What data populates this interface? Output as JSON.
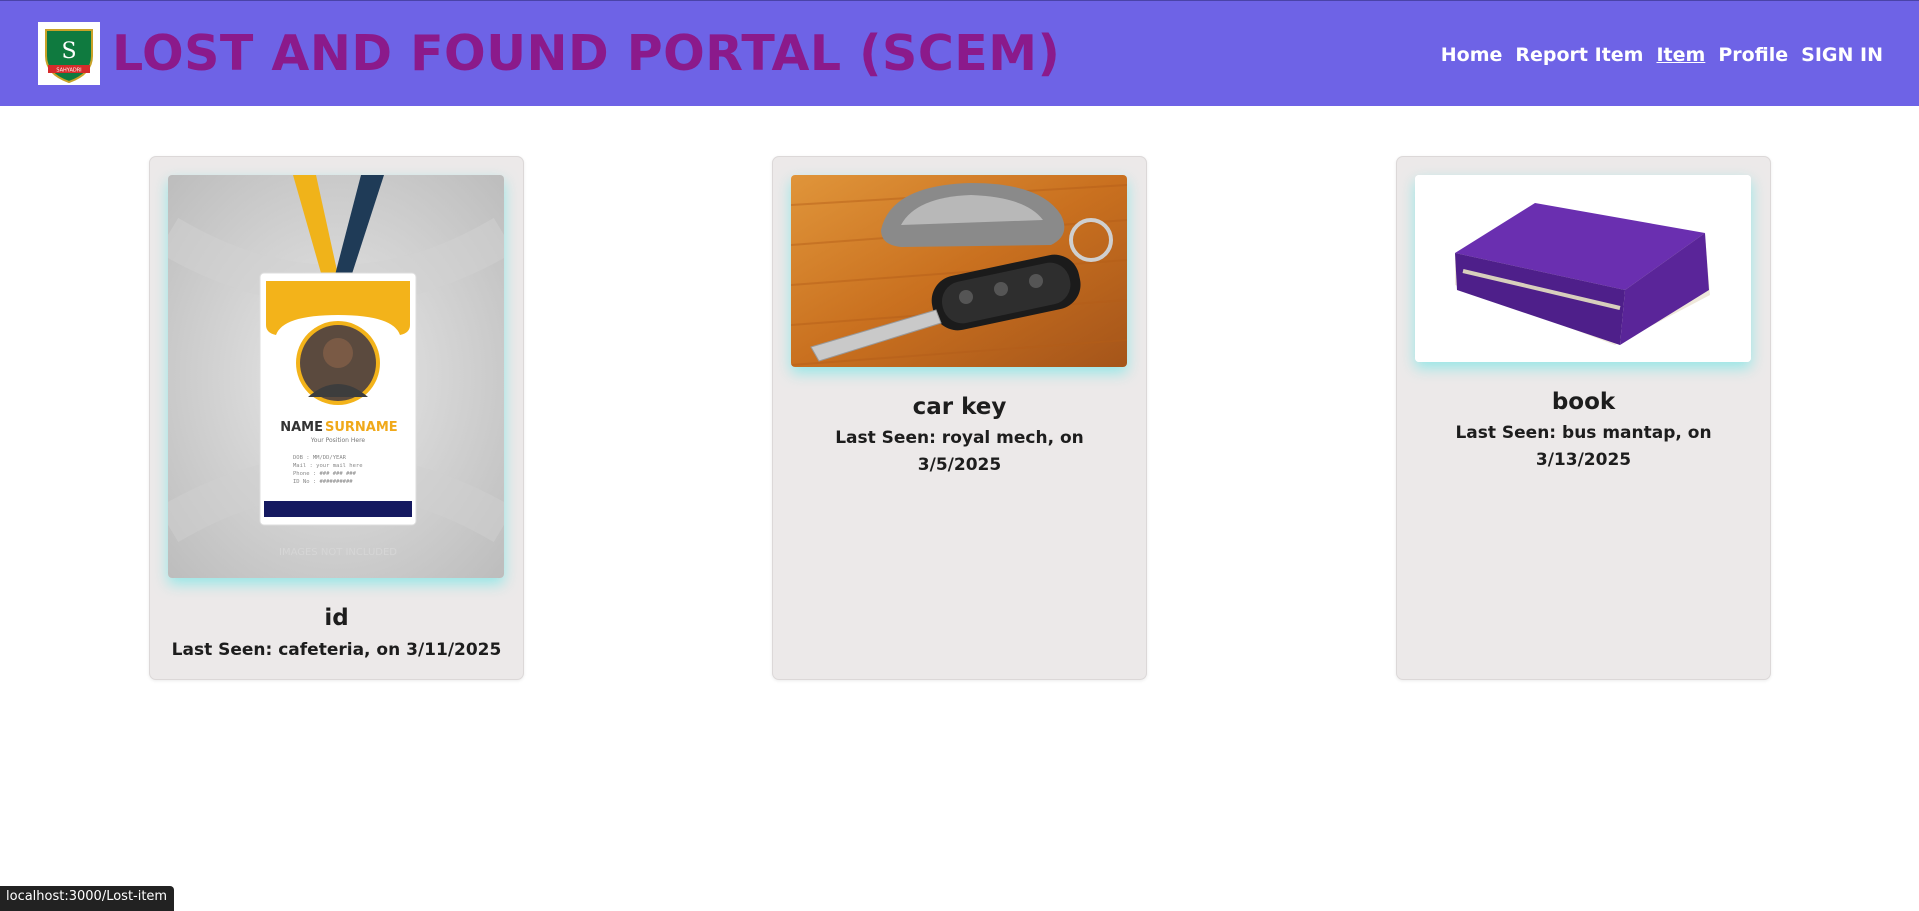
{
  "header": {
    "title": "LOST AND FOUND PORTAL (SCEM)",
    "logo_letter": "S",
    "logo_banner": "SAHYADRI",
    "nav": [
      {
        "label": "Home"
      },
      {
        "label": "Report Item"
      },
      {
        "label": "Item"
      },
      {
        "label": "Profile"
      },
      {
        "label": "SIGN IN"
      }
    ]
  },
  "items": [
    {
      "name": "id",
      "last_seen": "Last Seen: cafeteria, on 3/11/2025",
      "image": "id-card-photo",
      "card_name_text": "NAME",
      "card_surname_text": "SURNAME",
      "card_position_text": "Your Position Here",
      "card_fields": [
        "DOB  : MM/DD/YEAR",
        "Mail  : your mail here",
        "Phone : ### ### ###",
        "ID No : ##########"
      ],
      "watermark": "IMAGES NOT INCLUDED"
    },
    {
      "name": "car key",
      "last_seen": "Last Seen: royal mech, on 3/5/2025",
      "image": "car-key-photo"
    },
    {
      "name": "book",
      "last_seen": "Last Seen: bus mantap, on 3/13/2025",
      "image": "book-photo"
    }
  ],
  "status_bar": {
    "url": "localhost:3000/Lost-item"
  },
  "colors": {
    "header_bg": "#6e63e6",
    "title": "#8b1a8b",
    "card_bg": "#ece9e9",
    "glow": "#78e6e6"
  }
}
